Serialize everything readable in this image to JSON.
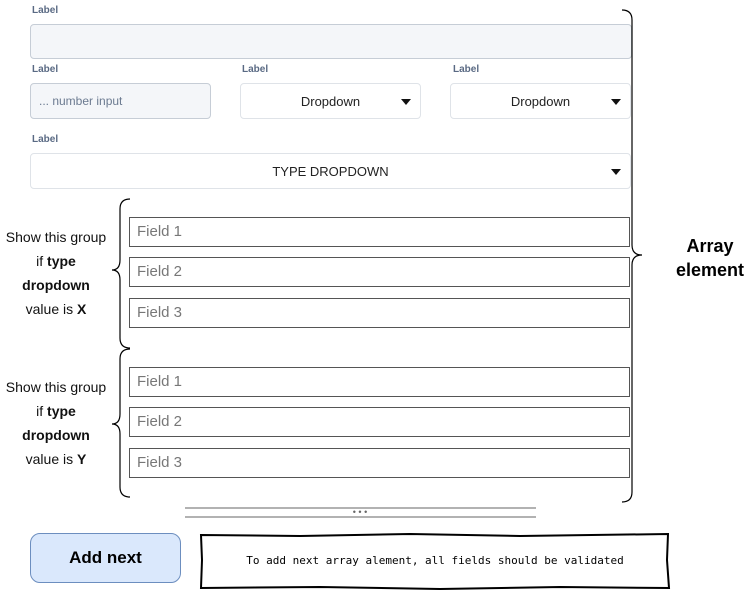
{
  "form": {
    "label_top": "Label",
    "label_number": "Label",
    "label_dropdown_1": "Label",
    "label_dropdown_2": "Label",
    "label_type": "Label",
    "number_placeholder": "... number input",
    "dropdown_1": "Dropdown",
    "dropdown_2": "Dropdown",
    "type_dropdown": "TYPE DROPDOWN"
  },
  "group_x": {
    "caption_pre": "Show this group",
    "caption_if": "if",
    "caption_bold_1": "type",
    "caption_bold_2": "dropdown",
    "caption_value": "value is",
    "caption_value_bold": "X",
    "fields": [
      "Field 1",
      "Field 2",
      "Field 3"
    ]
  },
  "group_y": {
    "caption_pre": "Show this group",
    "caption_if": "if",
    "caption_bold_1": "type",
    "caption_bold_2": "dropdown",
    "caption_value": "value is",
    "caption_value_bold": "Y",
    "fields": [
      "Field 1",
      "Field 2",
      "Field 3"
    ]
  },
  "array_label_line1": "Array",
  "array_label_line2": "element",
  "separator_text": "• • •",
  "add_button": "Add next",
  "note": "To add next array alement, all fields should be validated",
  "colors": {
    "button_fill": "#dae8fc",
    "button_border": "#6c8ebf",
    "label_color": "#5a6a84"
  }
}
